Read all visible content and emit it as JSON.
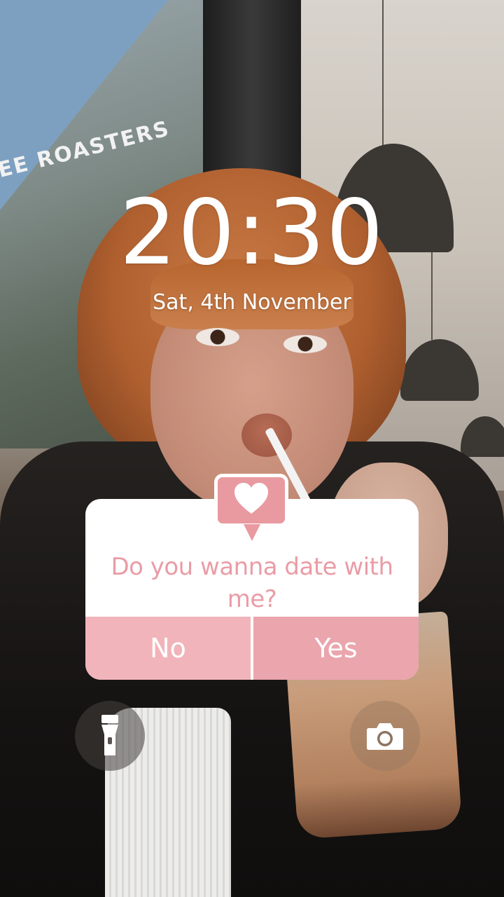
{
  "lockscreen": {
    "time": "20:30",
    "date": "Sat, 4th November"
  },
  "background": {
    "sign_text": "EE ROASTERS"
  },
  "dialog": {
    "icon": "heart-speech-bubble-icon",
    "question": "Do you wanna date with me?",
    "no_label": "No",
    "yes_label": "Yes",
    "colors": {
      "accent": "#e89aa0",
      "no_button": "#f1b4bb",
      "yes_button": "#eaa5ad",
      "question_text": "#ea9ca6"
    }
  },
  "shortcuts": {
    "left_icon": "flashlight-icon",
    "right_icon": "camera-icon"
  }
}
